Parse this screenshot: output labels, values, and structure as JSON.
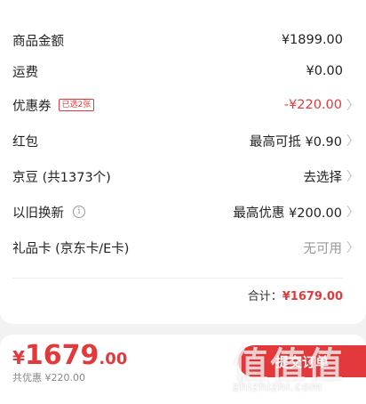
{
  "summary": {
    "rows": [
      {
        "label": "商品金额",
        "value": "¥1899.00"
      },
      {
        "label": "运费",
        "value": "¥0.00"
      },
      {
        "label": "优惠券",
        "tag": "已选2张",
        "value": "-¥220.00"
      },
      {
        "label": "红包",
        "value": "最高可抵 ¥0.90"
      },
      {
        "label": "京豆 (共1373个)",
        "value": "去选择"
      },
      {
        "label": "以旧换新",
        "info": "i",
        "value": "最高优惠 ¥200.00"
      },
      {
        "label": "礼品卡 (京东卡/E卡)",
        "value": "无可用"
      }
    ],
    "total_label": "合计：",
    "total_value": "¥1679.00"
  },
  "bottom": {
    "currency": "¥",
    "price_int": "1679",
    "price_dec": ".00",
    "saved": "共优惠 ¥220.00",
    "submit_label": "提交订单"
  },
  "watermark": {
    "mark": "值值值",
    "url": "zhizhizhi.com"
  },
  "colors": {
    "accent": "#e4393c",
    "background": "#f2f2f2"
  },
  "icons": {
    "arrow": "chevron-right-icon",
    "info": "info-icon"
  }
}
